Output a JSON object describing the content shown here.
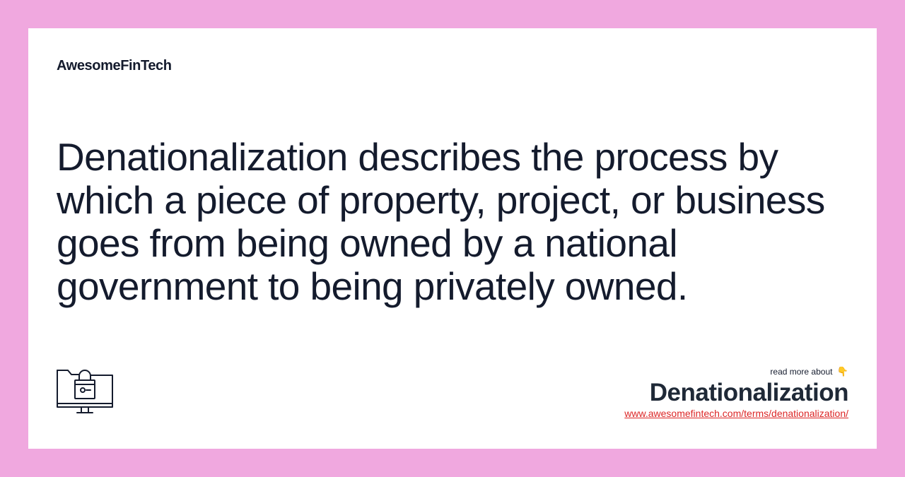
{
  "brand": {
    "name": "AwesomeFinTech"
  },
  "definition": {
    "text": "Denationalization describes the process by which a piece of property, project, or business goes from being owned by a national government to being privately owned."
  },
  "cta": {
    "read_more_label": "read more about",
    "pointer_emoji": "👇",
    "term": "Denationalization",
    "url": "www.awesomefintech.com/terms/denationalization/"
  },
  "icons": {
    "main": "computer-lock-icon"
  },
  "colors": {
    "background": "#f0a8df",
    "card": "#ffffff",
    "text": "#141b2d",
    "link": "#dc2626"
  }
}
